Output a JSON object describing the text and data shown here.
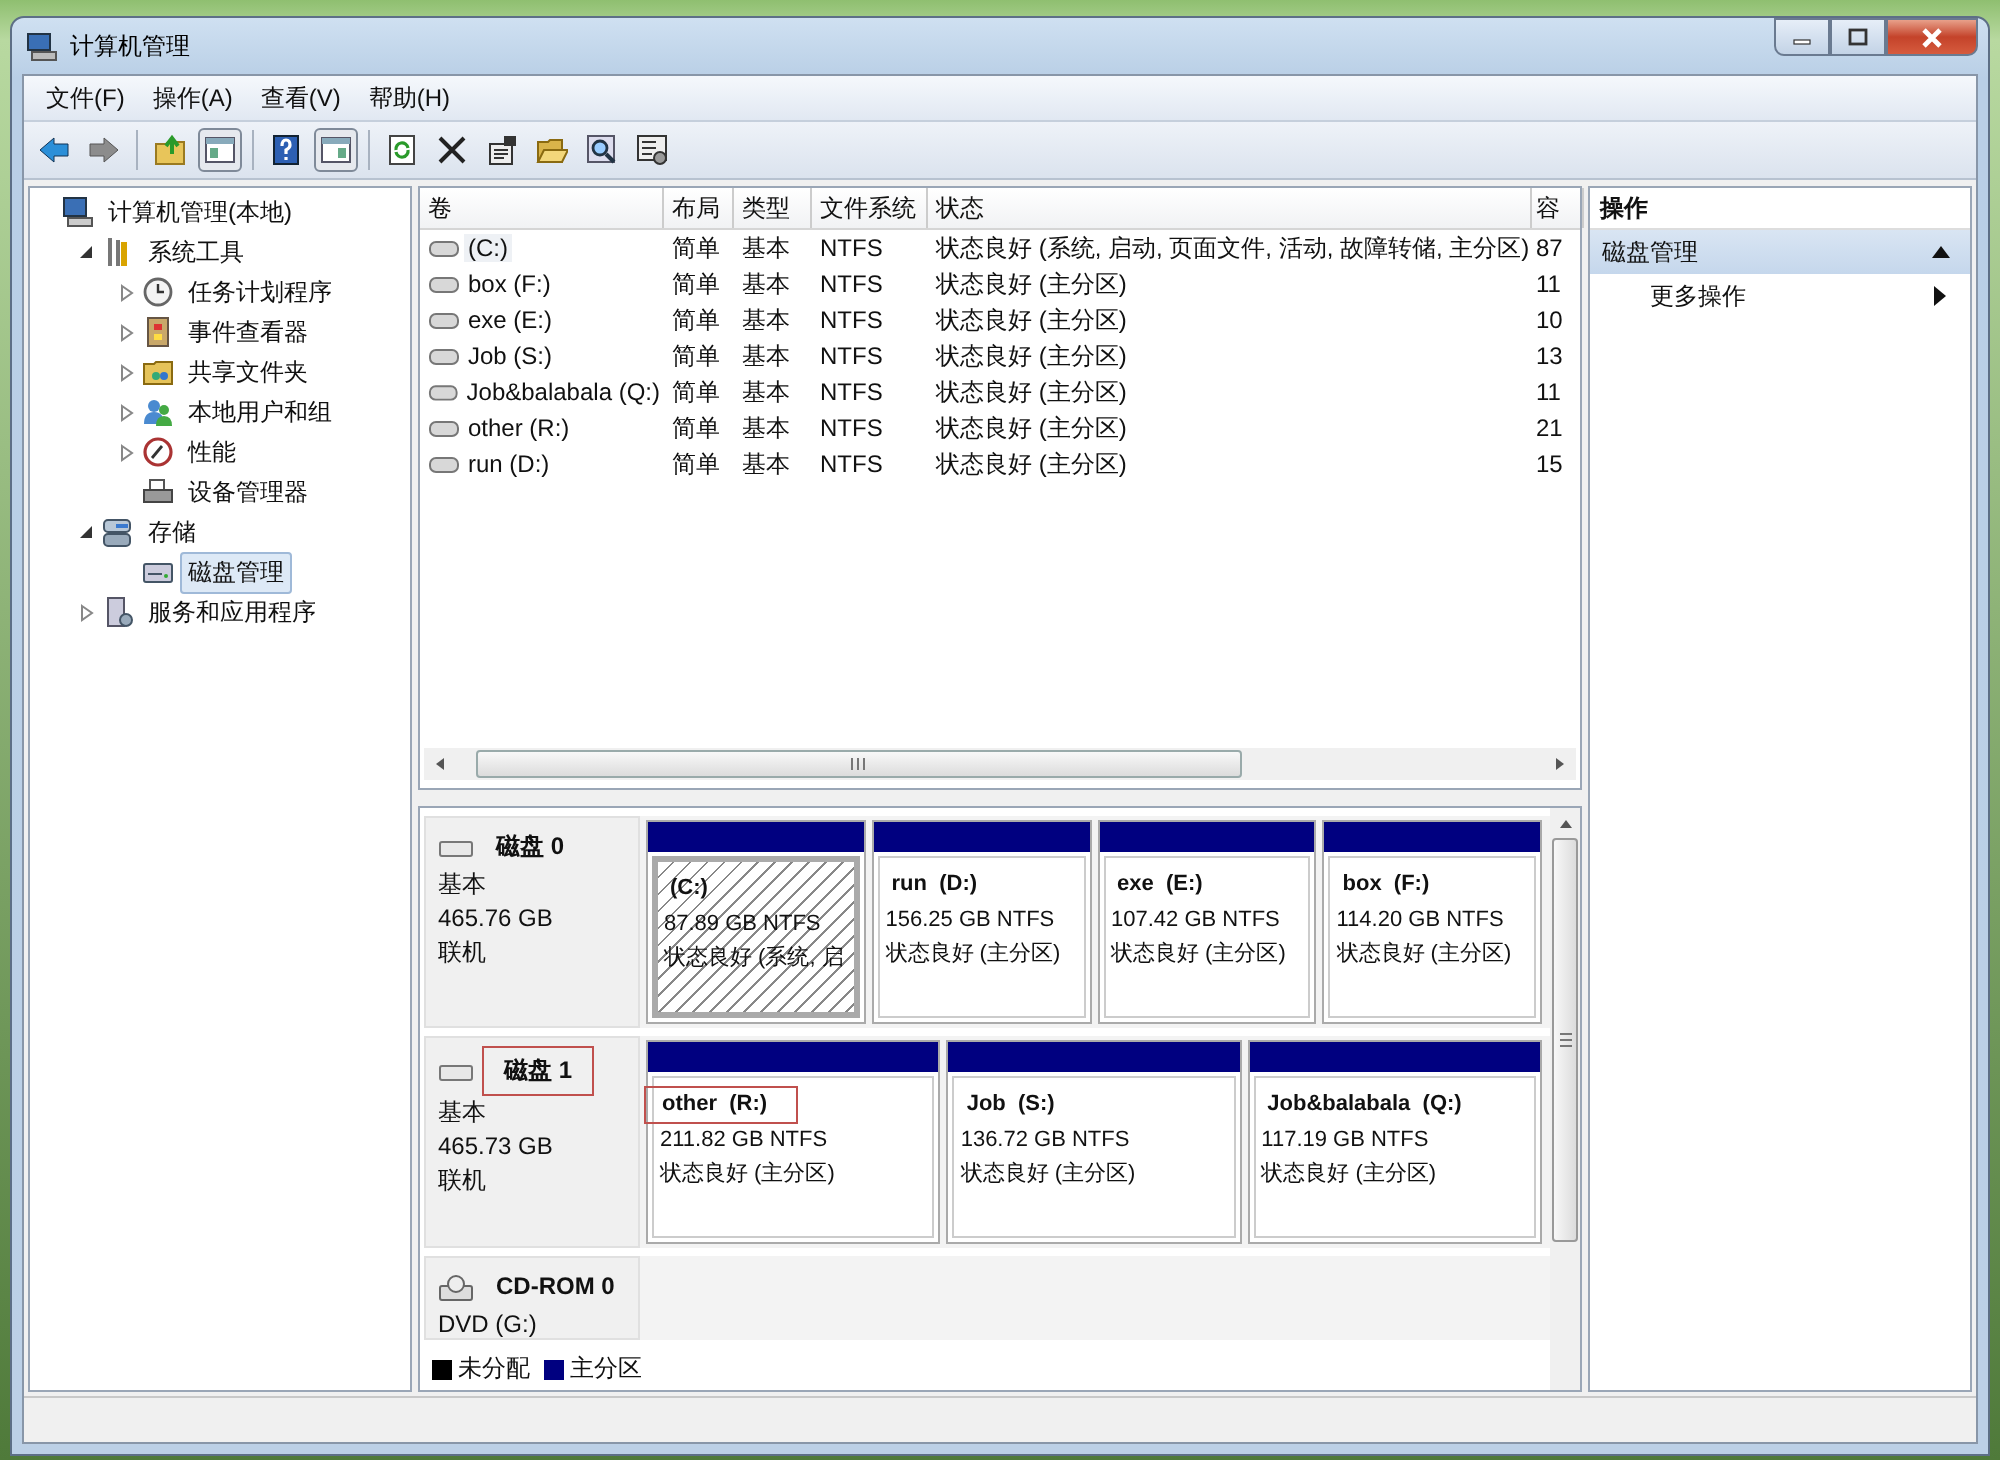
{
  "window": {
    "title": "计算机管理"
  },
  "menu": [
    {
      "label": "文件(F)"
    },
    {
      "label": "操作(A)"
    },
    {
      "label": "查看(V)"
    },
    {
      "label": "帮助(H)"
    }
  ],
  "toolbar": [
    {
      "kind": "back",
      "disabled": false
    },
    {
      "kind": "forward",
      "disabled": true
    },
    {
      "kind": "sep"
    },
    {
      "kind": "up"
    },
    {
      "kind": "tree",
      "pressed": true
    },
    {
      "kind": "sep"
    },
    {
      "kind": "help"
    },
    {
      "kind": "pane",
      "pressed": true
    },
    {
      "kind": "sep"
    },
    {
      "kind": "refresh"
    },
    {
      "kind": "delete"
    },
    {
      "kind": "props"
    },
    {
      "kind": "open"
    },
    {
      "kind": "find"
    },
    {
      "kind": "settings"
    }
  ],
  "tree": [
    {
      "label": "计算机管理(本地)",
      "kind": "computer",
      "selected": false,
      "children": [
        {
          "label": "系统工具",
          "kind": "tools",
          "expanded": true,
          "selected": false,
          "children": [
            {
              "label": "任务计划程序",
              "kind": "clock",
              "expanded": false,
              "selected": false
            },
            {
              "label": "事件查看器",
              "kind": "log",
              "expanded": false,
              "selected": false
            },
            {
              "label": "共享文件夹",
              "kind": "share",
              "expanded": false,
              "selected": false
            },
            {
              "label": "本地用户和组",
              "kind": "users",
              "expanded": false,
              "selected": false
            },
            {
              "label": "性能",
              "kind": "perf",
              "expanded": false,
              "selected": false
            },
            {
              "label": "设备管理器",
              "kind": "device",
              "selected": false
            }
          ]
        },
        {
          "label": "存储",
          "kind": "storage",
          "expanded": true,
          "selected": false,
          "children": [
            {
              "label": "磁盘管理",
              "kind": "disk",
              "selected": true
            }
          ]
        },
        {
          "label": "服务和应用程序",
          "kind": "services",
          "expanded": false,
          "selected": false
        }
      ]
    }
  ],
  "volumes": {
    "columns": [
      "卷",
      "布局",
      "类型",
      "文件系统",
      "状态",
      "容"
    ],
    "rows": [
      {
        "cells": [
          "(C:)",
          "简单",
          "基本",
          "NTFS",
          "状态良好 (系统, 启动, 页面文件, 活动, 故障转储, 主分区)",
          "87"
        ],
        "selected": true
      },
      {
        "cells": [
          "box (F:)",
          "简单",
          "基本",
          "NTFS",
          "状态良好 (主分区)",
          "11"
        ],
        "selected": false
      },
      {
        "cells": [
          "exe (E:)",
          "简单",
          "基本",
          "NTFS",
          "状态良好 (主分区)",
          "10"
        ],
        "selected": false
      },
      {
        "cells": [
          "Job (S:)",
          "简单",
          "基本",
          "NTFS",
          "状态良好 (主分区)",
          "13"
        ],
        "selected": false
      },
      {
        "cells": [
          "Job&balabala (Q:)",
          "简单",
          "基本",
          "NTFS",
          "状态良好 (主分区)",
          "11"
        ],
        "selected": false
      },
      {
        "cells": [
          "other (R:)",
          "简单",
          "基本",
          "NTFS",
          "状态良好 (主分区)",
          "21"
        ],
        "selected": false
      },
      {
        "cells": [
          "run (D:)",
          "简单",
          "基本",
          "NTFS",
          "状态良好 (主分区)",
          "15"
        ],
        "selected": false
      }
    ]
  },
  "disks": [
    {
      "kind": "disk",
      "name": "磁盘 0",
      "type": "基本",
      "size": "465.76 GB",
      "status": "联机",
      "highlighted": false,
      "partitions": [
        {
          "name": "(C:)",
          "size": "87.89 GB NTFS",
          "status": "状态良好 (系统, 启",
          "selected": true,
          "highlighted": false
        },
        {
          "name": "run  (D:)",
          "size": "156.25 GB NTFS",
          "status": "状态良好 (主分区)",
          "selected": false,
          "highlighted": false
        },
        {
          "name": "exe  (E:)",
          "size": "107.42 GB NTFS",
          "status": "状态良好 (主分区)",
          "selected": false,
          "highlighted": false
        },
        {
          "name": "box  (F:)",
          "size": "114.20 GB NTFS",
          "status": "状态良好 (主分区)",
          "selected": false,
          "highlighted": false
        }
      ]
    },
    {
      "kind": "disk",
      "name": "磁盘 1",
      "type": "基本",
      "size": "465.73 GB",
      "status": "联机",
      "highlighted": true,
      "partitions": [
        {
          "name": "other  (R:)",
          "size": "211.82 GB NTFS",
          "status": "状态良好 (主分区)",
          "selected": false,
          "highlighted": true
        },
        {
          "name": "Job  (S:)",
          "size": "136.72 GB NTFS",
          "status": "状态良好 (主分区)",
          "selected": false,
          "highlighted": false
        },
        {
          "name": "Job&balabala  (Q:)",
          "size": "117.19 GB NTFS",
          "status": "状态良好 (主分区)",
          "selected": false,
          "highlighted": false
        }
      ]
    },
    {
      "kind": "cdrom",
      "name": "CD-ROM 0",
      "type": "DVD (G:)",
      "highlighted": false
    }
  ],
  "legend": [
    {
      "label": "未分配",
      "color": "#000000"
    },
    {
      "label": "主分区",
      "color": "#000080"
    }
  ],
  "actions": {
    "title": "操作",
    "sections": [
      {
        "label": "磁盘管理",
        "expanded": true,
        "items": [
          {
            "label": "更多操作"
          }
        ]
      }
    ]
  }
}
